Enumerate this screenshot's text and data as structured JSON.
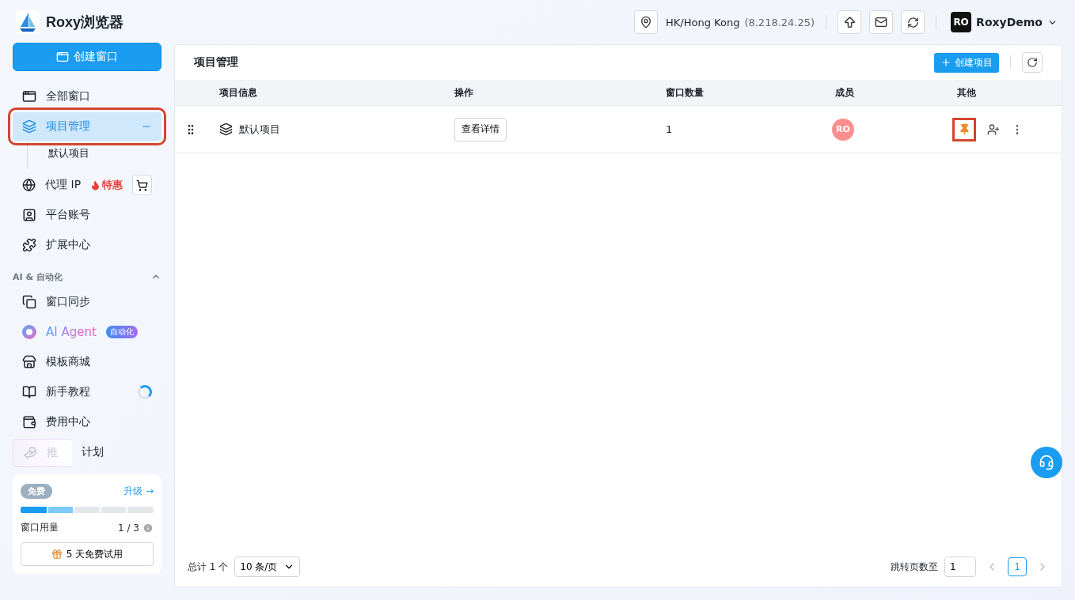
{
  "app": {
    "name": "Roxy浏览器"
  },
  "create_window_button": "创建窗口",
  "nav": [
    {
      "label": "全部窗口",
      "selected": false,
      "annotated": false
    },
    {
      "label": "项目管理",
      "selected": true,
      "annotated": true,
      "expanded": true,
      "children": [
        {
          "label": "默认项目",
          "selected": false
        }
      ]
    },
    {
      "label": "代理 IP",
      "selected": false,
      "annotated": false,
      "badge": "特惠"
    },
    {
      "label": "平台账号",
      "selected": false,
      "annotated": false
    },
    {
      "label": "扩展中心",
      "selected": false,
      "annotated": false
    }
  ],
  "ai_section": {
    "title": "AI & 自动化",
    "expanded": true,
    "items": [
      {
        "kind": "plain",
        "label": "窗口同步"
      },
      {
        "kind": "agent",
        "label": "AI Agent",
        "tag": "自动化"
      },
      {
        "kind": "plain",
        "label": "模板商城"
      },
      {
        "kind": "loading",
        "label": "新手教程"
      },
      {
        "kind": "plain",
        "label": "费用中心"
      },
      {
        "kind": "covered",
        "label_start": "推",
        "label": "计划"
      }
    ]
  },
  "plan": {
    "badge": "免费",
    "upgrade": "升级",
    "upgrade_arrow": "→",
    "level": 0.2,
    "usage_label": "窗口用量",
    "usage": "1 / 3",
    "trial_button": "5 天免费试用"
  },
  "topbar": {
    "location": "HK/Hong Kong",
    "ip": "(8.218.24.25)",
    "avatar": "RO",
    "user": "RoxyDemo"
  },
  "panel": {
    "title": "项目管理",
    "create_button": "创建项目"
  },
  "table": {
    "columns": [
      "项目信息",
      "操作",
      "窗口数量",
      "成员",
      "其他"
    ],
    "rows": [
      {
        "name": "默认项目",
        "action": "查看详情",
        "windows": "1",
        "member": "RO",
        "pinned": true,
        "annotated": true
      }
    ]
  },
  "pagination": {
    "total": "总计 1 个",
    "page_size": "10 条/页",
    "jump_label": "跳转页数至",
    "jump_value": "1",
    "pages": [
      {
        "label": "1",
        "selected": true
      }
    ]
  }
}
